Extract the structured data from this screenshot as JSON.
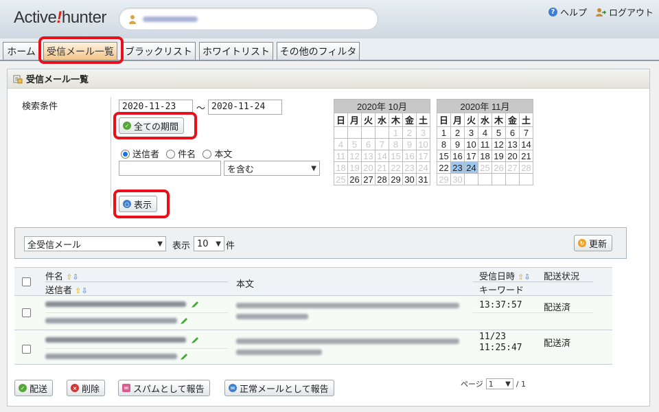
{
  "header": {
    "logo_pre": "Active",
    "logo_bang": "!",
    "logo_post": "hunter",
    "help_label": "ヘルプ",
    "logout_label": "ログアウト"
  },
  "tabs": [
    {
      "label": "ホーム"
    },
    {
      "label": "受信メール一覧"
    },
    {
      "label": "ブラックリスト"
    },
    {
      "label": "ホワイトリスト"
    },
    {
      "label": "その他のフィルタ"
    }
  ],
  "panel": {
    "title": "受信メール一覧",
    "search_label": "検索条件",
    "date_from": "2020-11-23",
    "date_sep": "～",
    "date_to": "2020-11-24",
    "all_period_label": "全ての期間",
    "radio_sender": "送信者",
    "radio_subject": "件名",
    "radio_body": "本文",
    "match_select": "を含む",
    "show_label": "表示"
  },
  "calendars": [
    {
      "title": "2020年 10月",
      "weekdays": [
        "日",
        "月",
        "火",
        "水",
        "木",
        "金",
        "土"
      ],
      "weeks": [
        [
          "",
          "",
          "",
          "",
          "1",
          "2",
          "3"
        ],
        [
          "4",
          "5",
          "6",
          "7",
          "8",
          "9",
          "10"
        ],
        [
          "11",
          "12",
          "13",
          "14",
          "15",
          "16",
          "17"
        ],
        [
          "18",
          "19",
          "20",
          "21",
          "22",
          "23",
          "24"
        ],
        [
          "25",
          "26",
          "27",
          "28",
          "29",
          "30",
          "31"
        ]
      ],
      "enabled_from": "26"
    },
    {
      "title": "2020年 11月",
      "weekdays": [
        "日",
        "月",
        "火",
        "水",
        "木",
        "金",
        "土"
      ],
      "weeks": [
        [
          "1",
          "2",
          "3",
          "4",
          "5",
          "6",
          "7"
        ],
        [
          "8",
          "9",
          "10",
          "11",
          "12",
          "13",
          "14"
        ],
        [
          "15",
          "16",
          "17",
          "18",
          "19",
          "20",
          "21"
        ],
        [
          "22",
          "23",
          "24",
          "25",
          "26",
          "27",
          "28"
        ],
        [
          "29",
          "30",
          "",
          "",
          "",
          "",
          ""
        ]
      ],
      "enabled_to": "24",
      "selected": [
        "23",
        "24"
      ]
    }
  ],
  "filter": {
    "mail_select": "全受信メール",
    "show_count_label": "表示",
    "count": "10",
    "count_suffix": "件",
    "refresh_label": "更新"
  },
  "table": {
    "col_subject": "件名",
    "col_sender": "送信者",
    "col_body": "本文",
    "col_received": "受信日時",
    "col_status": "配送状況",
    "col_keyword": "キーワード",
    "rows": [
      {
        "received": "13:37:57",
        "status": "配送済"
      },
      {
        "received_date": "11/23",
        "received": "11:25:47",
        "status": "配送済"
      }
    ]
  },
  "actions": {
    "deliver": "配送",
    "delete": "削除",
    "report_spam": "スパムとして報告",
    "report_ham": "正常メールとして報告"
  },
  "pager": {
    "label": "ページ",
    "current": "1",
    "total": "/ 1"
  }
}
